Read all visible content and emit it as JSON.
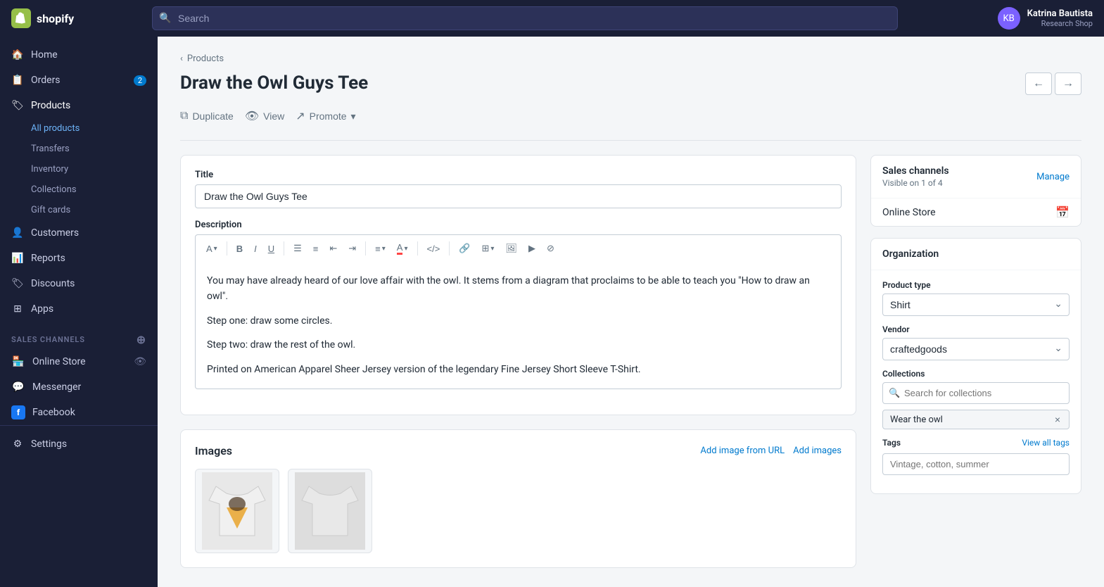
{
  "topbar": {
    "logo_text": "shopify",
    "search_placeholder": "Search",
    "user_name": "Katrina Bautista",
    "user_shop": "Research Shop"
  },
  "sidebar": {
    "nav_items": [
      {
        "id": "home",
        "label": "Home",
        "icon": "home"
      },
      {
        "id": "orders",
        "label": "Orders",
        "icon": "orders",
        "badge": "2"
      },
      {
        "id": "products",
        "label": "Products",
        "icon": "products",
        "active": true
      }
    ],
    "sub_items": [
      {
        "id": "all-products",
        "label": "All products",
        "active": true
      },
      {
        "id": "transfers",
        "label": "Transfers"
      },
      {
        "id": "inventory",
        "label": "Inventory"
      },
      {
        "id": "collections",
        "label": "Collections"
      },
      {
        "id": "gift-cards",
        "label": "Gift cards"
      }
    ],
    "other_nav": [
      {
        "id": "customers",
        "label": "Customers",
        "icon": "customers"
      },
      {
        "id": "reports",
        "label": "Reports",
        "icon": "reports"
      },
      {
        "id": "discounts",
        "label": "Discounts",
        "icon": "discounts"
      },
      {
        "id": "apps",
        "label": "Apps",
        "icon": "apps"
      }
    ],
    "sales_channels_label": "SALES CHANNELS",
    "channels": [
      {
        "id": "online-store",
        "label": "Online Store",
        "icon": "store",
        "has_eye": true
      },
      {
        "id": "messenger",
        "label": "Messenger",
        "icon": "messenger"
      },
      {
        "id": "facebook",
        "label": "Facebook",
        "icon": "facebook"
      }
    ],
    "settings_label": "Settings"
  },
  "breadcrumb": {
    "label": "Products",
    "back_icon": "‹"
  },
  "page": {
    "title": "Draw the Owl Guys Tee",
    "prev_icon": "←",
    "next_icon": "→"
  },
  "actions": {
    "duplicate_label": "Duplicate",
    "view_label": "View",
    "promote_label": "Promote"
  },
  "form": {
    "title_label": "Title",
    "title_value": "Draw the Owl Guys Tee",
    "description_label": "Description",
    "description_paragraphs": [
      "You may have already heard of our love affair with the owl. It stems from a diagram that proclaims to be able to teach you \"How to draw an owl\".",
      "Step one: draw some circles.",
      "Step two: draw the rest of the owl.",
      "Printed on American Apparel Sheer Jersey version of the legendary Fine Jersey Short Sleeve T-Shirt."
    ]
  },
  "editor_toolbar": {
    "format_label": "A",
    "bold": "B",
    "italic": "I",
    "underline": "U",
    "ul": "≡",
    "ol": "≡",
    "outdent": "⇤",
    "indent": "⇥",
    "align": "≡",
    "color": "A",
    "source": "</>",
    "link": "🔗",
    "table": "⊞",
    "image": "🖼",
    "video": "▶",
    "clear": "⊘"
  },
  "images": {
    "title": "Images",
    "add_url_label": "Add image from URL",
    "add_images_label": "Add images"
  },
  "right_panel": {
    "sales_channels": {
      "title": "Sales channels",
      "manage_label": "Manage",
      "visible_text": "Visible on 1 of 4",
      "channels": [
        {
          "label": "Online Store"
        }
      ]
    },
    "organization": {
      "title": "Organization",
      "product_type_label": "Product type",
      "product_type_value": "Shirt",
      "vendor_label": "Vendor",
      "vendor_value": "craftedgoods"
    },
    "collections": {
      "title": "Collections",
      "search_placeholder": "Search for collections",
      "tags": [
        "Wear the owl"
      ]
    },
    "tags": {
      "title": "Tags",
      "view_all_label": "View all tags",
      "placeholder": "Vintage, cotton, summer"
    }
  }
}
